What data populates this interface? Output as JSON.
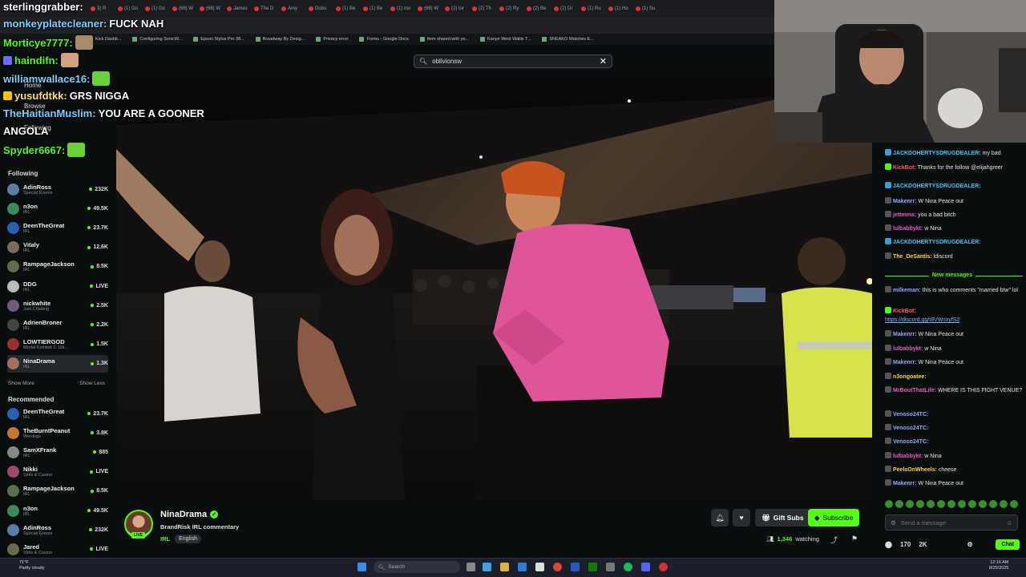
{
  "browser": {
    "tabs": [
      "3) R",
      "(1) Go",
      "(1) Go",
      "(66) W",
      "(66) W",
      "James",
      "The D",
      "Amy",
      "Dubo",
      "(1) Be",
      "(1) Be",
      "(1) mo",
      "(66) W",
      "(2) tor",
      "(2) Th",
      "(2) Ry",
      "(2) Be",
      "(2) Dr",
      "(1) Ru",
      "(1) Ho",
      "(1) Su"
    ],
    "bookmarks": [
      "Kick Dashb...",
      "Configuring SonicW...",
      "Epson Stylus Pro 38...",
      "Broadway By Desig...",
      "Privacy error",
      "Forms - Google Docs",
      "Item shared with yo...",
      "Kanye West Wallis T...",
      "SNEAKO Watches E..."
    ]
  },
  "search": {
    "value": "oblivionsw"
  },
  "sidebar": {
    "nav": [
      "Home",
      "Browse",
      "Following"
    ],
    "following_title": "Following",
    "following": [
      {
        "name": "AdinRoss",
        "category": "Special Events",
        "count": "232K",
        "color": "#5a7da8"
      },
      {
        "name": "n3on",
        "category": "IRL",
        "count": "49.5K",
        "color": "#3d8a5c"
      },
      {
        "name": "DeenTheGreat",
        "category": "IRL",
        "count": "23.7K",
        "color": "#2b5fb0"
      },
      {
        "name": "Vitaly",
        "category": "IRL",
        "count": "12.6K",
        "color": "#7a6b5a"
      },
      {
        "name": "RampageJackson",
        "category": "IRL",
        "count": "8.5K",
        "color": "#5c6e4a"
      },
      {
        "name": "DDG",
        "category": "IRL",
        "count": "LIVE",
        "color": "#bbbbbb"
      },
      {
        "name": "nickwhite",
        "category": "Just Chatting",
        "count": "2.5K",
        "color": "#6e5a7a"
      },
      {
        "name": "AdrienBroner",
        "category": "IRL",
        "count": "2.2K",
        "color": "#444444"
      },
      {
        "name": "LOWTIERGOD",
        "category": "Mortal Kombat 1: Ulti...",
        "count": "1.5K",
        "color": "#9a3030"
      },
      {
        "name": "NinaDrama",
        "category": "IRL",
        "count": "1.3K",
        "color": "#a07060"
      }
    ],
    "show_more": "Show More",
    "show_less": "Show Less",
    "recommended_title": "Recommended",
    "recommended": [
      {
        "name": "DeenTheGreat",
        "category": "IRL",
        "count": "23.7K",
        "color": "#2b5fb0"
      },
      {
        "name": "TheBurntPeanut",
        "category": "Werdogs",
        "count": "3.8K",
        "color": "#c27a2c"
      },
      {
        "name": "SamXFrank",
        "category": "IRL",
        "count": "885",
        "color": "#888888"
      },
      {
        "name": "Nikki",
        "category": "Slots & Casino",
        "count": "LIVE",
        "color": "#9a4a6a"
      },
      {
        "name": "RampageJackson",
        "category": "IRL",
        "count": "8.5K",
        "color": "#5c6e4a"
      },
      {
        "name": "n3on",
        "category": "IRL",
        "count": "49.5K",
        "color": "#3d8a5c"
      },
      {
        "name": "AdinRoss",
        "category": "Special Events",
        "count": "232K",
        "color": "#5a7da8"
      },
      {
        "name": "Jared",
        "category": "Slots & Casino",
        "count": "LIVE",
        "color": "#6a6a4a"
      }
    ]
  },
  "overlay_chat": [
    {
      "user": "sterlinggrabber:",
      "text": "",
      "style": "white"
    },
    {
      "user": "monkeyplatecleaner:",
      "text": "FUCK NAH",
      "style": "cyan"
    },
    {
      "user": "Morticye7777:",
      "text": "",
      "style": "green"
    },
    {
      "user": "haindifn:",
      "text": "",
      "style": "green"
    },
    {
      "user": "williamwallace16:",
      "text": "",
      "style": "cyan"
    },
    {
      "user": "yusufdtkk:",
      "text": "GRS NIGGA",
      "style": "gold"
    },
    {
      "user": "TheHaitianMuslim:",
      "text": "YOU ARE A GOONER",
      "style": "cyan"
    },
    {
      "user": "",
      "text": "ANGOLA",
      "style": "white"
    },
    {
      "user": "Spyder6667:",
      "text": "",
      "style": "green"
    }
  ],
  "chat": {
    "messages": [
      {
        "user": "JACKDOHERTYSDRUGDEALER:",
        "text": "my bad",
        "color": "cy"
      },
      {
        "user": "KickBot:",
        "text": "Thanks for the follow @elijahgreer",
        "color": "rd"
      },
      {
        "user": "JACKDOHERTYSDRUGDEALER:",
        "text": "",
        "color": "cy"
      },
      {
        "user": "Makenrr:",
        "text": "W Nina Peace out",
        "color": "bl"
      },
      {
        "user": "jettmma:",
        "text": "you a bad bitch",
        "color": "pk"
      },
      {
        "user": "lulbabbykt:",
        "text": "w Nina",
        "color": "pk"
      },
      {
        "user": "JACKDOHERTYSDRUGDEALER:",
        "text": "",
        "color": "cy"
      },
      {
        "user": "The_DeSantis:",
        "text": "ldiscord",
        "color": "yl"
      }
    ],
    "new_messages_label": "New messages",
    "messages2": [
      {
        "user": "milkeman:",
        "text": "this is who comments \"married btw\" lol",
        "color": "bl"
      },
      {
        "user": "KickBot:",
        "text": "",
        "color": "rd"
      },
      {
        "user": "",
        "text": "https://discord.gg/t8VWsxyfS2",
        "color": "link"
      },
      {
        "user": "Makenrr:",
        "text": "W Nina Peace out",
        "color": "bl"
      },
      {
        "user": "lulbabbykt:",
        "text": "w Nina",
        "color": "pk"
      },
      {
        "user": "Makenrr:",
        "text": "W Nina Peace out",
        "color": "bl"
      },
      {
        "user": "n3ongoatee:",
        "text": "",
        "color": "yl"
      },
      {
        "user": "MrBoutThatLife:",
        "text": "WHERE IS THIS FIGHT VENUE?",
        "color": "pk"
      },
      {
        "user": "Venoso24TC:",
        "text": "",
        "color": "bl"
      },
      {
        "user": "Venoso24TC:",
        "text": "",
        "color": "bl"
      },
      {
        "user": "Venoso24TC:",
        "text": "",
        "color": "bl"
      },
      {
        "user": "lulbabbykt:",
        "text": "w Nina",
        "color": "pk"
      },
      {
        "user": "PeelsOnWheels:",
        "text": "cheese",
        "color": "yl"
      },
      {
        "user": "Makenrr:",
        "text": "W Nina Peace out",
        "color": "bl"
      }
    ],
    "input_placeholder": "Send a message",
    "points": "170",
    "k_points": "2K",
    "chat_button": "Chat"
  },
  "stream": {
    "name": "NinaDrama",
    "title": "BrandRisk IRL commentary",
    "category": "IRL",
    "language": "English",
    "gift_label": "Gift Subs",
    "subscribe_label": "Subscribe",
    "watching_count": "1,346",
    "watching_label": "watching",
    "live_badge": "LIVE"
  },
  "taskbar": {
    "weather_temp": "71°F",
    "weather_desc": "Partly cloudy",
    "search_placeholder": "Search",
    "time": "12:16 AM",
    "date": "8/25/2025"
  },
  "colors": {
    "kick_green": "#53fc18",
    "bg": "#0b0e0f"
  }
}
